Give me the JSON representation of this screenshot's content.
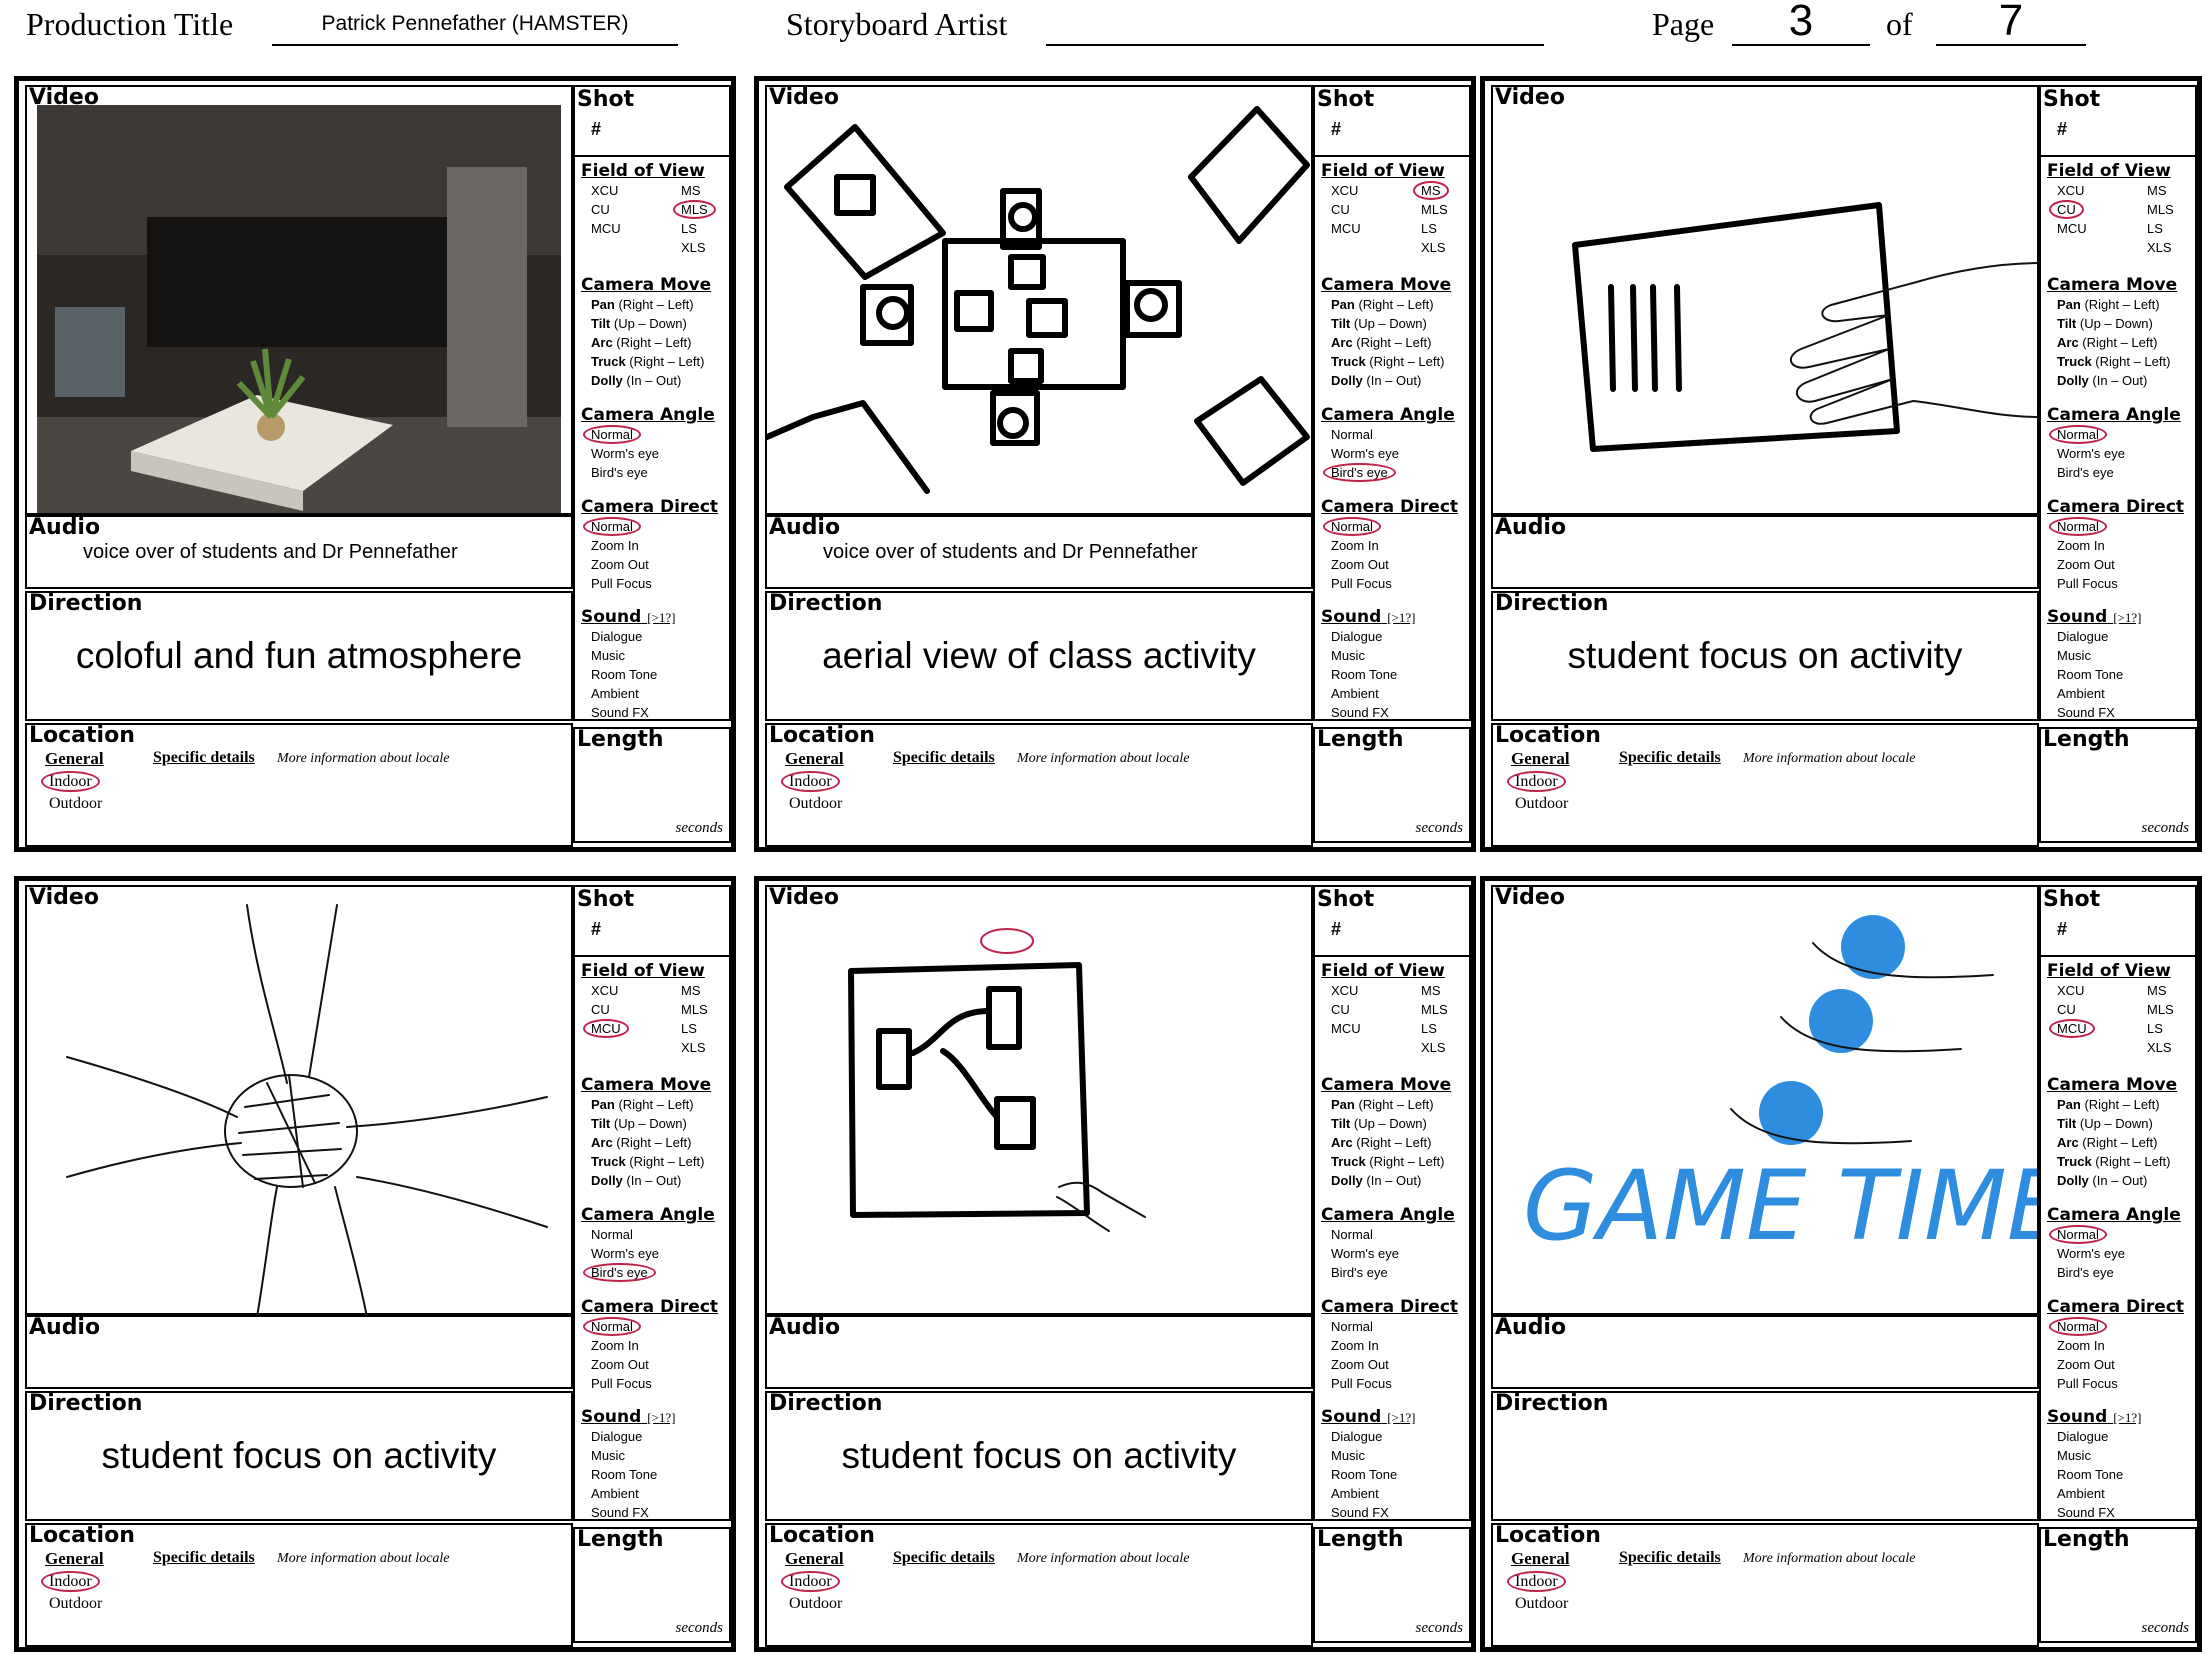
{
  "header": {
    "production_title_label": "Production Title",
    "production_title_value": "Patrick Pennefather (HAMSTER)",
    "storyboard_artist_label": "Storyboard Artist",
    "storyboard_artist_value": "",
    "page_label": "Page",
    "page_number": "3",
    "of_label": "of",
    "page_total": "7"
  },
  "labels": {
    "video": "Video",
    "audio": "Audio",
    "direction": "Direction",
    "location": "Location",
    "shot": "Shot",
    "shot_hash": "#",
    "length": "Length",
    "seconds": "seconds",
    "field_of_view": "Field of View",
    "camera_move": "Camera Move",
    "camera_angle": "Camera Angle",
    "camera_direct": "Camera Direct",
    "sound": "Sound",
    "sound_hint": "[>1?]",
    "general": "General",
    "specific_details": "Specific details",
    "more_info": "More information about locale",
    "fov_options": [
      "XCU",
      "MS",
      "CU",
      "MLS",
      "MCU",
      "LS",
      "",
      "XLS"
    ],
    "camera_move_options": [
      {
        "bold": "Pan",
        "rest": " (Right – Left)"
      },
      {
        "bold": "Tilt",
        "rest": " (Up – Down)"
      },
      {
        "bold": "Arc",
        "rest": " (Right – Left)"
      },
      {
        "bold": "Truck",
        "rest": " (Right – Left)"
      },
      {
        "bold": "Dolly",
        "rest": " (In – Out)"
      }
    ],
    "camera_angle_options": [
      "Normal",
      "Worm's eye",
      "Bird's eye"
    ],
    "camera_direct_options": [
      "Normal",
      "Zoom In",
      "Zoom Out",
      "Pull Focus"
    ],
    "sound_options": [
      "Dialogue",
      "Music",
      "Room Tone",
      "Ambient",
      "Sound FX"
    ],
    "location_options": [
      "Indoor",
      "Outdoor"
    ]
  },
  "panels": [
    {
      "audio": "voice over of students and Dr Pennefather",
      "direction": "coloful and fun atmosphere",
      "sel_fov": "MLS",
      "sel_angle": "Normal",
      "sel_direct": "Normal",
      "sel_location": "Indoor",
      "sketch": "photo"
    },
    {
      "audio": "voice over of students and Dr Pennefather",
      "direction": "aerial view of class activity",
      "sel_fov": "MS",
      "sel_angle": "Bird's eye",
      "sel_direct": "Normal",
      "sel_location": "Indoor",
      "sketch": "aerial"
    },
    {
      "audio": "",
      "direction": "student focus on activity",
      "sel_fov": "CU",
      "sel_angle": "Normal",
      "sel_direct": "Normal",
      "sel_location": "Indoor",
      "sketch": "handpaper"
    },
    {
      "audio": "",
      "direction": "student focus on activity",
      "sel_fov": "MCU",
      "sel_angle": "Bird's eye",
      "sel_direct": "Normal",
      "sel_location": "Indoor",
      "sketch": "hands"
    },
    {
      "audio": "",
      "direction": "student focus on activity",
      "sel_fov": "",
      "sel_angle": "",
      "sel_direct": "",
      "sel_location": "Indoor",
      "sketch": "board"
    },
    {
      "audio": "",
      "direction": "",
      "sel_fov": "MCU",
      "sel_angle": "Normal",
      "sel_direct": "Normal",
      "sel_location": "Indoor",
      "sketch": "game",
      "sketch_text": "GAME TIME"
    }
  ],
  "colors": {
    "selection": "#c0224a",
    "game_blue": "#2f8de0"
  }
}
